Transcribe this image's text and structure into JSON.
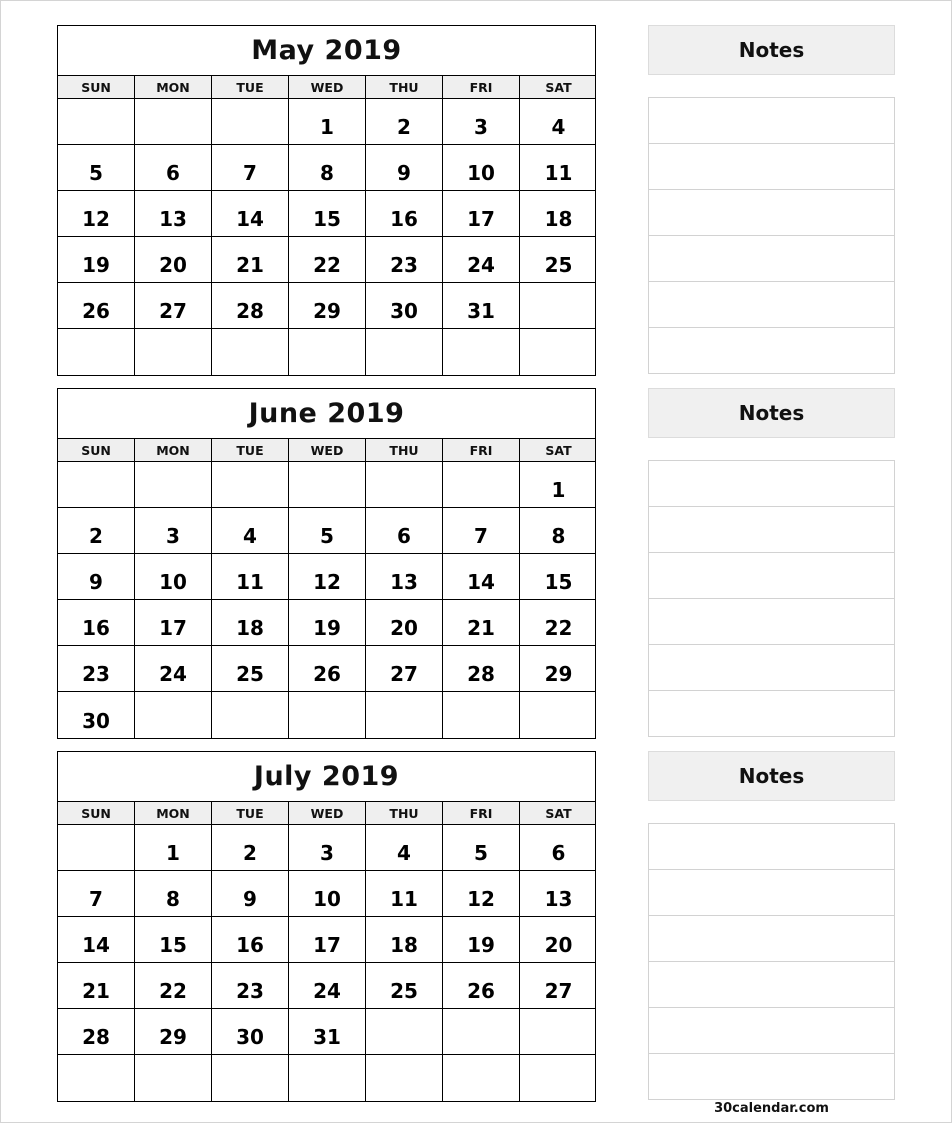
{
  "days_of_week": [
    "SUN",
    "MON",
    "TUE",
    "WED",
    "THU",
    "FRI",
    "SAT"
  ],
  "months": [
    {
      "title": "May 2019",
      "weeks": [
        [
          "",
          "",
          "",
          "1",
          "2",
          "3",
          "4"
        ],
        [
          "5",
          "6",
          "7",
          "8",
          "9",
          "10",
          "11"
        ],
        [
          "12",
          "13",
          "14",
          "15",
          "16",
          "17",
          "18"
        ],
        [
          "19",
          "20",
          "21",
          "22",
          "23",
          "24",
          "25"
        ],
        [
          "26",
          "27",
          "28",
          "29",
          "30",
          "31",
          ""
        ],
        [
          "",
          "",
          "",
          "",
          "",
          "",
          ""
        ]
      ],
      "notes_label": "Notes"
    },
    {
      "title": "June 2019",
      "weeks": [
        [
          "",
          "",
          "",
          "",
          "",
          "",
          "1"
        ],
        [
          "2",
          "3",
          "4",
          "5",
          "6",
          "7",
          "8"
        ],
        [
          "9",
          "10",
          "11",
          "12",
          "13",
          "14",
          "15"
        ],
        [
          "16",
          "17",
          "18",
          "19",
          "20",
          "21",
          "22"
        ],
        [
          "23",
          "24",
          "25",
          "26",
          "27",
          "28",
          "29"
        ],
        [
          "30",
          "",
          "",
          "",
          "",
          "",
          ""
        ]
      ],
      "notes_label": "Notes"
    },
    {
      "title": "July 2019",
      "weeks": [
        [
          "",
          "1",
          "2",
          "3",
          "4",
          "5",
          "6"
        ],
        [
          "7",
          "8",
          "9",
          "10",
          "11",
          "12",
          "13"
        ],
        [
          "14",
          "15",
          "16",
          "17",
          "18",
          "19",
          "20"
        ],
        [
          "21",
          "22",
          "23",
          "24",
          "25",
          "26",
          "27"
        ],
        [
          "28",
          "29",
          "30",
          "31",
          "",
          "",
          ""
        ],
        [
          "",
          "",
          "",
          "",
          "",
          "",
          ""
        ]
      ],
      "notes_label": "Notes"
    }
  ],
  "footer": "30calendar.com"
}
